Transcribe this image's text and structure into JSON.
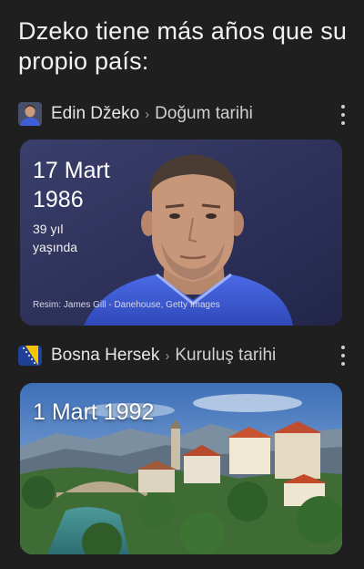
{
  "meme": {
    "caption": "Dzeko tiene más años que su propio país:"
  },
  "result1": {
    "entity": "Edin Džeko",
    "attribute": "Doğum tarihi",
    "date": "17 Mart 1986",
    "age_value": "39 yıl",
    "age_unit": "yaşında",
    "image_credit": "Resim: James Gill - Danehouse, Getty Images",
    "avatar_icon": "person-photo-icon"
  },
  "result2": {
    "entity": "Bosna Hersek",
    "attribute": "Kuruluş tarihi",
    "date": "1 Mart 1992",
    "flag_icon": "bosnia-flag-icon"
  },
  "colors": {
    "background": "#1f1f1f",
    "card1_bg": "#2b2f55",
    "jersey_blue": "#3f5fd8",
    "flag_blue": "#1f3f99",
    "flag_yellow": "#f6c400"
  }
}
